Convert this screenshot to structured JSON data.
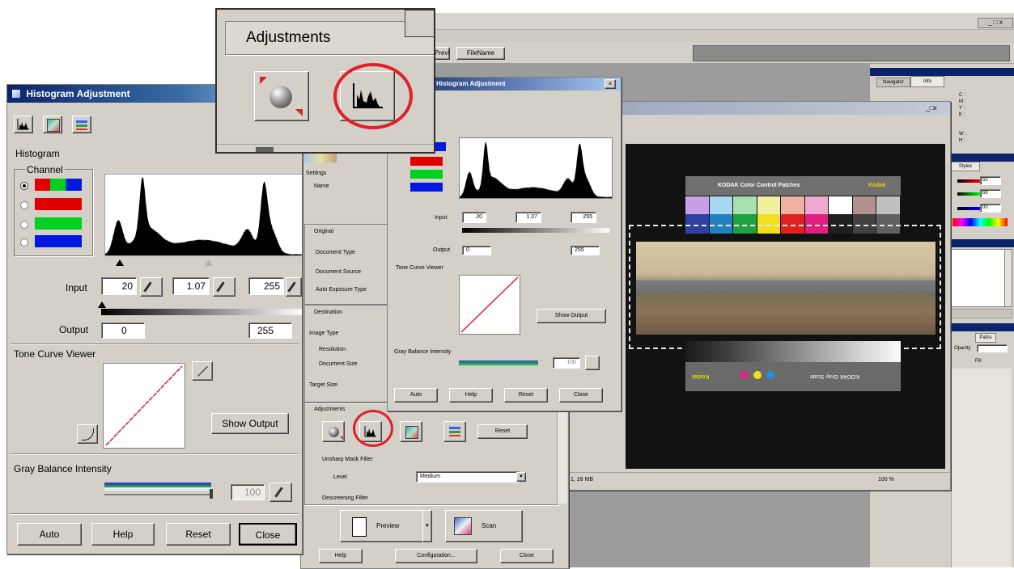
{
  "histogram_dialog": {
    "title": "Histogram Adjustment",
    "histogram_label": "Histogram",
    "channel_label": "Channel",
    "input_label": "Input",
    "input_black": "20",
    "input_gamma": "1.07",
    "input_white": "255",
    "output_label": "Output",
    "output_black": "0",
    "output_white": "255",
    "tone_curve_label": "Tone Curve Viewer",
    "show_output_button": "Show Output",
    "gray_balance_label": "Gray Balance Intensity",
    "gray_balance_value": "100",
    "buttons": {
      "auto": "Auto",
      "help": "Help",
      "reset": "Reset",
      "close": "Close"
    }
  },
  "zoom_adjustments": {
    "label": "Adjustments"
  },
  "scan_window": {
    "toolbar_buttons": [
      "Preview",
      "FileName"
    ],
    "side_panel": {
      "settings_label": "Settings",
      "name_label": "Name",
      "original_section": "Original",
      "document_type_label": "Document Type",
      "document_source_label": "Document Source",
      "auto_exposure_label": "Auto Exposure Type",
      "destination_section": "Destination",
      "image_type_label": "Image Type",
      "resolution_label": "Resolution",
      "document_size_label": "Document Size",
      "target_size_label": "Target Size",
      "adjustments_section": "Adjustments",
      "reset_button": "Reset",
      "unsharp_label": "Unsharp Mask Filter",
      "level_label": "Level",
      "level_value": "Medium",
      "descreening_label": "Descreening Filter",
      "preview_button": "Preview",
      "scan_button": "Scan",
      "help_button": "Help",
      "configuration_button": "Configuration...",
      "close_button": "Close"
    },
    "status_left": "1, 28 MB",
    "status_right": "100 %",
    "target": {
      "color_title": "KODAK Color Control Patches",
      "brand": "Kodak",
      "gray_title": "KODAK Gray Scale",
      "gray_brand": "Kodak"
    },
    "small_histogram": {
      "title": "Histogram Adjustment",
      "input_label": "Input",
      "input_black": "20",
      "input_gamma": "1.07",
      "input_white": "255",
      "output_label": "Output",
      "output_black": "0",
      "output_white": "255",
      "tone_curve_label": "Tone Curve Viewer",
      "show_output_button": "Show Output",
      "gray_balance_label": "Gray Balance Intensity",
      "gray_balance_value": "100",
      "buttons": {
        "auto": "Auto",
        "help": "Help",
        "reset": "Reset",
        "close": "Close"
      }
    }
  },
  "right_palettes": {
    "info_tabs": [
      "Navigator",
      "Info"
    ],
    "info_cmyk": "C : M : Y : K :",
    "info_wh": "W : H :",
    "styles_tab": "Styles",
    "rgb_values": [
      "50",
      "66",
      "00"
    ],
    "paths_tab": "Paths",
    "opacity_label": "Opacity",
    "fill_label": "Fill"
  },
  "colors": {
    "accent_circle": "#e0202a",
    "titlebar": "#0a246a",
    "dialog_bg": "#d4d0c8"
  }
}
